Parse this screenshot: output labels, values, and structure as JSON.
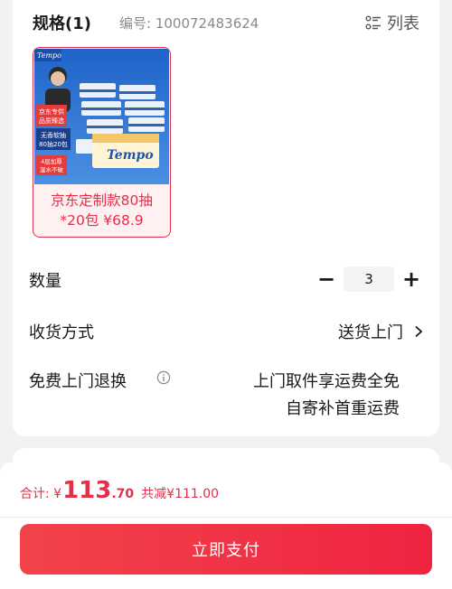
{
  "spec": {
    "title": "规格(1)",
    "code": "编号: 100072483624",
    "list_label": "列表"
  },
  "sku": {
    "image_texts": [
      "Tempo",
      "京东专供",
      "品质臻选",
      "无香软抽",
      "80抽20包",
      "4层加厚",
      "湿水不破"
    ],
    "label_line1": "京东定制款80抽",
    "label_line2": "*20包 ¥68.9"
  },
  "quantity": {
    "label": "数量",
    "minus": "−",
    "value": "3",
    "plus": "+"
  },
  "delivery": {
    "label": "收货方式",
    "value": "送货上门"
  },
  "free_return": {
    "label": "免费上门退换",
    "line1": "上门取件享运费全免",
    "line2": "自寄补首重运费"
  },
  "footer": {
    "total_label": "合计: ¥",
    "total_int": "113",
    "total_dec": ".70",
    "saving": "共减¥111.00",
    "pay_label": "立即支付"
  },
  "colors": {
    "accent": "#e3304a",
    "pay_button": "#f2434a"
  },
  "icons": [
    "list-icon",
    "chevron-right-icon",
    "info-icon"
  ]
}
